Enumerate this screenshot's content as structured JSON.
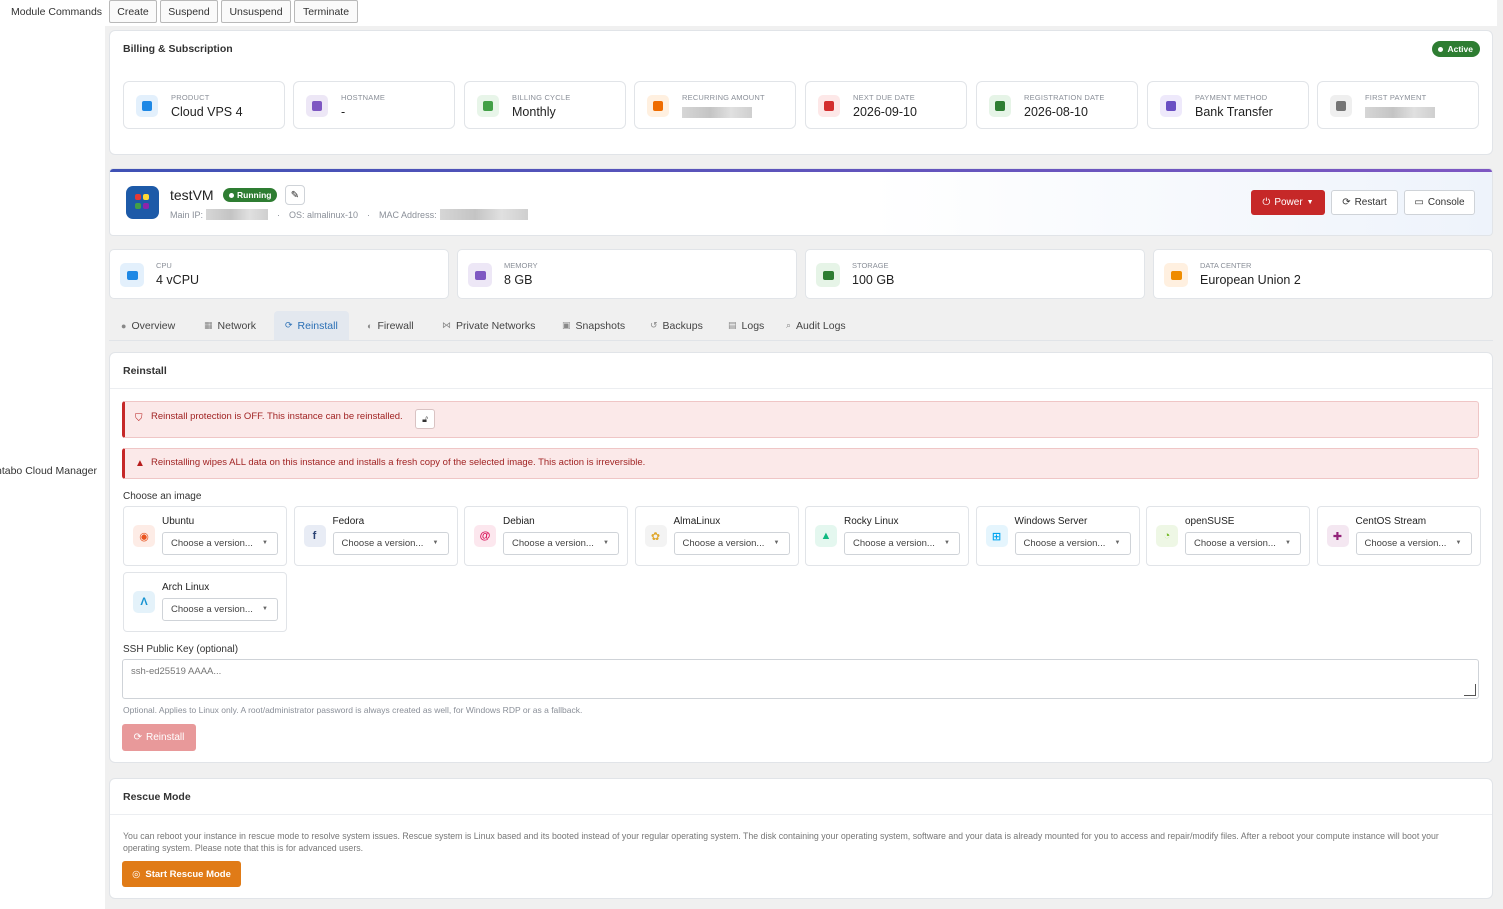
{
  "module_commands": {
    "label": "Module Commands",
    "buttons": [
      "Create",
      "Suspend",
      "Unsuspend",
      "Terminate"
    ]
  },
  "side_label": "ntabo Cloud Manager",
  "billing": {
    "title": "Billing & Subscription",
    "status": "Active",
    "stats": [
      {
        "label": "PRODUCT",
        "value": "Cloud VPS 4",
        "icon": "cube-icon",
        "color": "#1e88e5",
        "bg": "#e3f0fc"
      },
      {
        "label": "HOSTNAME",
        "value": "-",
        "icon": "server-icon",
        "color": "#7e57c2",
        "bg": "#ede7f6"
      },
      {
        "label": "BILLING CYCLE",
        "value": "Monthly",
        "icon": "refresh-icon",
        "color": "#43a047",
        "bg": "#e8f5e9"
      },
      {
        "label": "RECURRING AMOUNT",
        "value": "",
        "icon": "coins-icon",
        "color": "#ef6c00",
        "bg": "#fff0e0"
      },
      {
        "label": "NEXT DUE DATE",
        "value": "2026-09-10",
        "icon": "calendar-icon",
        "color": "#d32f2f",
        "bg": "#fde8e8"
      },
      {
        "label": "REGISTRATION DATE",
        "value": "2026-08-10",
        "icon": "calendar-check-icon",
        "color": "#2e7d32",
        "bg": "#e6f4e7"
      },
      {
        "label": "PAYMENT METHOD",
        "value": "Bank Transfer",
        "icon": "bank-icon",
        "color": "#6a4fc3",
        "bg": "#eee9fb"
      },
      {
        "label": "FIRST PAYMENT",
        "value": "",
        "icon": "receipt-icon",
        "color": "#757575",
        "bg": "#efefef"
      }
    ]
  },
  "vm": {
    "name": "testVM",
    "status": "Running",
    "main_ip_label": "Main IP:",
    "os_label": "OS: almalinux-10",
    "mac_label": "MAC Address:",
    "power_label": "Power",
    "restart_label": "Restart",
    "console_label": "Console"
  },
  "specs": [
    {
      "label": "CPU",
      "value": "4 vCPU",
      "icon": "cpu-icon",
      "color": "#1e88e5",
      "bg": "#e3f0fc"
    },
    {
      "label": "MEMORY",
      "value": "8 GB",
      "icon": "memory-icon",
      "color": "#7e57c2",
      "bg": "#ede7f6"
    },
    {
      "label": "STORAGE",
      "value": "100 GB",
      "icon": "storage-icon",
      "color": "#2e7d32",
      "bg": "#e6f4e7"
    },
    {
      "label": "DATA CENTER",
      "value": "European Union 2",
      "icon": "datacenter-icon",
      "color": "#ef8c00",
      "bg": "#fff0e0"
    }
  ],
  "tabs": [
    {
      "label": "Overview",
      "icon": "info-icon",
      "glyph": "●"
    },
    {
      "label": "Network",
      "icon": "network-icon",
      "glyph": "▦"
    },
    {
      "label": "Reinstall",
      "icon": "refresh-icon",
      "glyph": "⟳"
    },
    {
      "label": "Firewall",
      "icon": "shield-icon",
      "glyph": "◐"
    },
    {
      "label": "Private Networks",
      "icon": "share-icon",
      "glyph": "⋈"
    },
    {
      "label": "Snapshots",
      "icon": "camera-icon",
      "glyph": "▣"
    },
    {
      "label": "Backups",
      "icon": "history-icon",
      "glyph": "↺"
    },
    {
      "label": "Logs",
      "icon": "file-icon",
      "glyph": "▤"
    },
    {
      "label": "Audit Logs",
      "icon": "search-icon",
      "glyph": "⌕"
    }
  ],
  "reinstall": {
    "title": "Reinstall",
    "protection_alert": "Reinstall protection is OFF. This instance can be reinstalled.",
    "wipe_alert": "Reinstalling wipes ALL data on this instance and installs a fresh copy of the selected image. This action is irreversible.",
    "choose_label": "Choose an image",
    "select_placeholder": "Choose a version...",
    "images": [
      {
        "name": "Ubuntu",
        "icon": "ubuntu-icon",
        "glyph": "◉",
        "color": "#e95420",
        "bg": "#fdece6"
      },
      {
        "name": "Fedora",
        "icon": "fedora-icon",
        "glyph": "f",
        "color": "#294172",
        "bg": "#e8ecf5"
      },
      {
        "name": "Debian",
        "icon": "debian-icon",
        "glyph": "@",
        "color": "#d70a53",
        "bg": "#fce7ee"
      },
      {
        "name": "AlmaLinux",
        "icon": "almalinux-icon",
        "glyph": "✿",
        "color": "#e0a82e",
        "bg": "#f3f3f3"
      },
      {
        "name": "Rocky Linux",
        "icon": "rocky-linux-icon",
        "glyph": "▲",
        "color": "#10b981",
        "bg": "#e4f7ef"
      },
      {
        "name": "Windows Server",
        "icon": "windows-icon",
        "glyph": "⊞",
        "color": "#00a4ef",
        "bg": "#e5f5fd"
      },
      {
        "name": "openSUSE",
        "icon": "opensuse-icon",
        "glyph": "◔",
        "color": "#73ba25",
        "bg": "#eef7e5"
      },
      {
        "name": "CentOS Stream",
        "icon": "centos-icon",
        "glyph": "✚",
        "color": "#932279",
        "bg": "#f4e7f1"
      },
      {
        "name": "Arch Linux",
        "icon": "arch-linux-icon",
        "glyph": "Λ",
        "color": "#1793d1",
        "bg": "#e4f2fa"
      }
    ],
    "ssh_label": "SSH Public Key (optional)",
    "ssh_placeholder": "ssh-ed25519 AAAA...",
    "ssh_help": "Optional. Applies to Linux only. A root/administrator password is always created as well, for Windows RDP or as a fallback.",
    "button_label": "Reinstall"
  },
  "rescue": {
    "title": "Rescue Mode",
    "text": "You can reboot your instance in rescue mode to resolve system issues. Rescue system is Linux based and its booted instead of your regular operating system. The disk containing your operating system, software and your data is already mounted for you to access and repair/modify files. After a reboot your compute instance will boot your operating system. Please note that this is for advanced users.",
    "button_label": "Start Rescue Mode"
  }
}
